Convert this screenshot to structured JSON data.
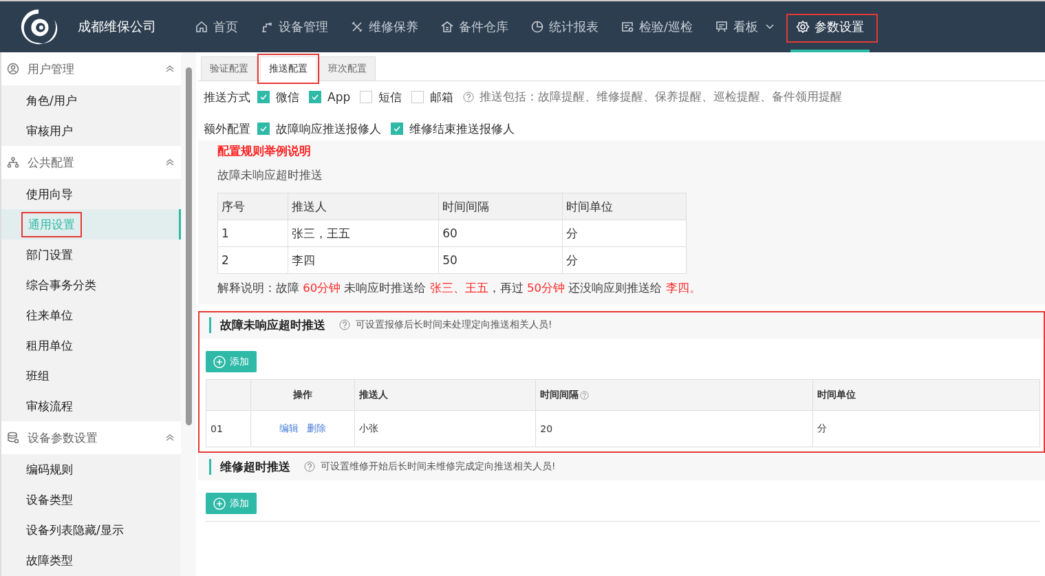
{
  "header": {
    "company": "成都维保公司",
    "nav": [
      {
        "label": "首页",
        "selected": false,
        "highlighted": false,
        "dropdown": false
      },
      {
        "label": "设备管理",
        "selected": false,
        "highlighted": false,
        "dropdown": false
      },
      {
        "label": "维修保养",
        "selected": false,
        "highlighted": false,
        "dropdown": false
      },
      {
        "label": "备件仓库",
        "selected": false,
        "highlighted": false,
        "dropdown": false
      },
      {
        "label": "统计报表",
        "selected": false,
        "highlighted": false,
        "dropdown": false
      },
      {
        "label": "检验/巡检",
        "selected": false,
        "highlighted": false,
        "dropdown": false
      },
      {
        "label": "看板",
        "selected": false,
        "highlighted": false,
        "dropdown": true
      },
      {
        "label": "参数设置",
        "selected": true,
        "highlighted": true,
        "dropdown": false
      }
    ]
  },
  "sidebar": {
    "groups": [
      {
        "label": "用户管理",
        "expanded": true,
        "children": [
          {
            "label": "角色/用户",
            "selected": false,
            "highlighted": false
          },
          {
            "label": "审核用户",
            "selected": false,
            "highlighted": false
          }
        ]
      },
      {
        "label": "公共配置",
        "expanded": true,
        "children": [
          {
            "label": "使用向导",
            "selected": false,
            "highlighted": false
          },
          {
            "label": "通用设置",
            "selected": true,
            "highlighted": true
          },
          {
            "label": "部门设置",
            "selected": false,
            "highlighted": false
          },
          {
            "label": "综合事务分类",
            "selected": false,
            "highlighted": false
          },
          {
            "label": "往来单位",
            "selected": false,
            "highlighted": false
          },
          {
            "label": "租用单位",
            "selected": false,
            "highlighted": false
          },
          {
            "label": "班组",
            "selected": false,
            "highlighted": false
          },
          {
            "label": "审核流程",
            "selected": false,
            "highlighted": false
          }
        ]
      },
      {
        "label": "设备参数设置",
        "expanded": true,
        "children": [
          {
            "label": "编码规则",
            "selected": false,
            "highlighted": false
          },
          {
            "label": "设备类型",
            "selected": false,
            "highlighted": false
          },
          {
            "label": "设备列表隐藏/显示",
            "selected": false,
            "highlighted": false
          },
          {
            "label": "故障类型",
            "selected": false,
            "highlighted": false
          }
        ]
      }
    ]
  },
  "tabs": [
    {
      "label": "验证配置",
      "selected": false,
      "highlighted": false
    },
    {
      "label": "推送配置",
      "selected": true,
      "highlighted": true
    },
    {
      "label": "班次配置",
      "selected": false,
      "highlighted": false
    }
  ],
  "push_method": {
    "label": "推送方式",
    "options": [
      {
        "label": "微信",
        "checked": true
      },
      {
        "label": "App",
        "checked": true
      },
      {
        "label": "短信",
        "checked": false
      },
      {
        "label": "邮箱",
        "checked": false
      }
    ],
    "note": "推送包括：故障提醒、维修提醒、保养提醒、巡检提醒、备件领用提醒"
  },
  "extra_config": {
    "label": "额外配置",
    "options": [
      {
        "label": "故障响应推送报修人",
        "checked": true
      },
      {
        "label": "维修结束推送报修人",
        "checked": true
      }
    ]
  },
  "example": {
    "title": "配置规则举例说明",
    "subtitle": "故障未响应超时推送",
    "columns": [
      "序号",
      "推送人",
      "时间间隔",
      "时间单位"
    ],
    "rows": [
      [
        "1",
        "张三，王五",
        "60",
        "分"
      ],
      [
        "2",
        "李四",
        "50",
        "分"
      ]
    ],
    "explanation": [
      {
        "text": "解释说明：故障 ",
        "red": false
      },
      {
        "text": "60分钟",
        "red": true
      },
      {
        "text": " 未响应时推送给 ",
        "red": false
      },
      {
        "text": "张三、王五",
        "red": true
      },
      {
        "text": "，再过 ",
        "red": false
      },
      {
        "text": "50分钟",
        "red": true
      },
      {
        "text": " 还没响应则推送给 ",
        "red": false
      },
      {
        "text": "李四。",
        "red": true
      }
    ]
  },
  "sections": [
    {
      "title": "故障未响应超时推送",
      "hint": "可设置报修后长时间未处理定向推送相关人员!",
      "highlighted": true,
      "add_button": "添加",
      "columns": [
        "操作",
        "推送人",
        "时间间隔",
        "时间单位"
      ],
      "rows": [
        {
          "no": "01",
          "actions": [
            "编辑",
            "删除"
          ],
          "person": "小张",
          "interval": "20",
          "unit": "分"
        }
      ]
    },
    {
      "title": "维修超时推送",
      "hint": "可设置维修开始后长时间未维修完成定向推送相关人员!",
      "highlighted": false,
      "add_button": "添加"
    }
  ]
}
